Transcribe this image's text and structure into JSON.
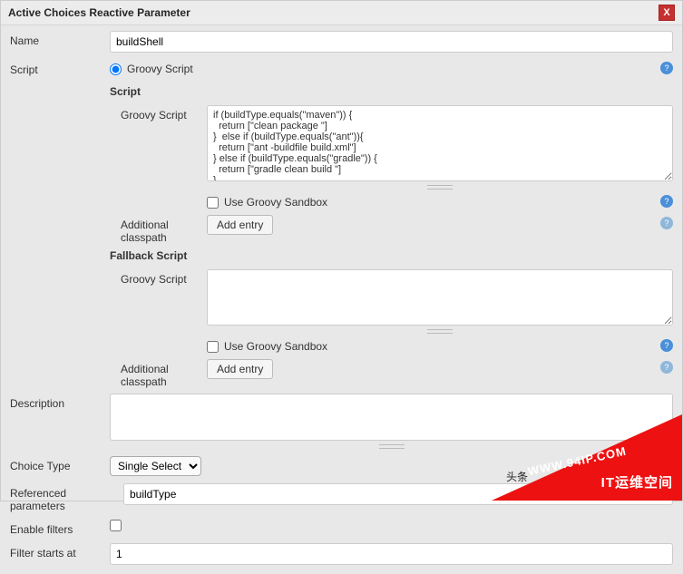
{
  "panel": {
    "title": "Active Choices Reactive Parameter"
  },
  "fields": {
    "name": {
      "label": "Name",
      "value": "buildShell"
    },
    "script": {
      "label": "Script",
      "radio_label": "Groovy Script",
      "main": {
        "title": "Script",
        "groovy_label": "Groovy Script",
        "groovy_value": "if (buildType.equals(\"maven\")) {\n  return [\"clean package \"]\n}  else if (buildType.equals(\"ant\")){\n  return [\"ant -buildfile build.xml\"]\n} else if (buildType.equals(\"gradle\")) {\n  return [\"gradle clean build \"]\n}",
        "sandbox_label": "Use Groovy Sandbox",
        "classpath_label": "Additional classpath",
        "add_entry_label": "Add entry"
      },
      "fallback": {
        "title": "Fallback Script",
        "groovy_label": "Groovy Script",
        "groovy_value": "",
        "sandbox_label": "Use Groovy Sandbox",
        "classpath_label": "Additional classpath",
        "add_entry_label": "Add entry"
      }
    },
    "description": {
      "label": "Description",
      "value": ""
    },
    "choice_type": {
      "label": "Choice Type",
      "value": "Single Select"
    },
    "referenced": {
      "label": "Referenced parameters",
      "value": "buildType"
    },
    "enable_filters": {
      "label": "Enable filters",
      "checked": false
    },
    "filter_starts_at": {
      "label": "Filter starts at",
      "value": "1"
    }
  },
  "watermark": {
    "text1": "WWW.94IP.COM",
    "text2": "IT运维空间",
    "prefix": "头条"
  }
}
